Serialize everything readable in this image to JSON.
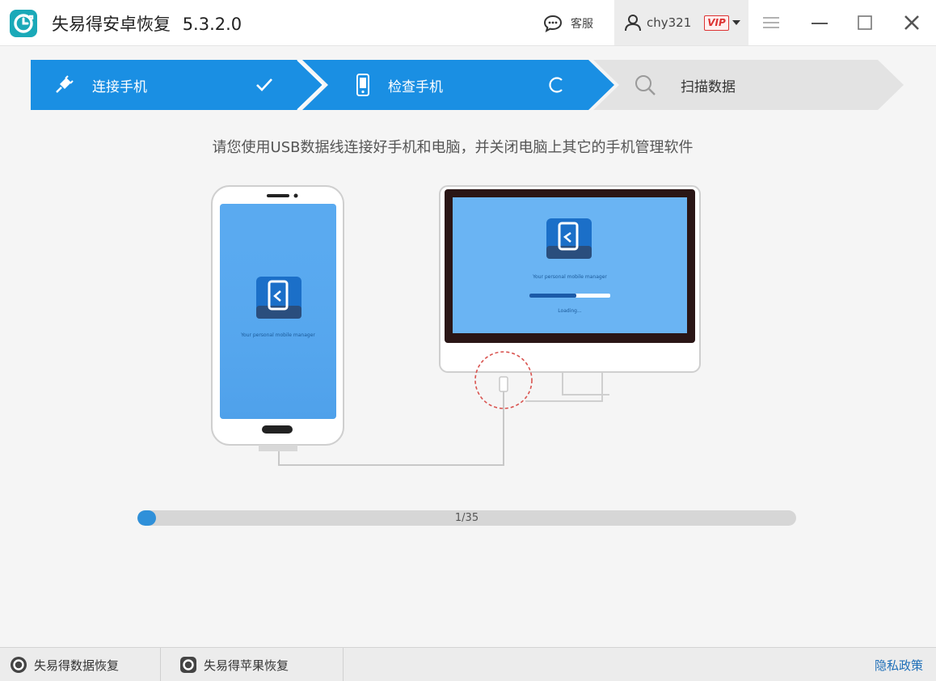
{
  "app": {
    "title": "失易得安卓恢复",
    "version": "5.3.2.0",
    "brand_color": "#1aa9b8"
  },
  "titlebar": {
    "service_label": "客服",
    "username": "chy321",
    "vip_label": "VIP"
  },
  "steps": [
    {
      "label": "连接手机",
      "state": "done",
      "icon": "plug-icon",
      "status_icon": "check-icon"
    },
    {
      "label": "检查手机",
      "state": "active",
      "icon": "phone-icon",
      "status_icon": "loading-icon"
    },
    {
      "label": "扫描数据",
      "state": "pending",
      "icon": "search-icon"
    }
  ],
  "colors": {
    "accent": "#1a8fe3",
    "pending": "#e3e3e3",
    "progress": "#2f90d9",
    "link": "#1f6fb8"
  },
  "instruction": "请您使用USB数据线连接好手机和电脑，并关闭电脑上其它的手机管理软件",
  "illustration": {
    "phone_caption": "Your personal mobile manager",
    "monitor_caption": "Your personal mobile manager",
    "monitor_loading": "Loading..."
  },
  "progress": {
    "current": 1,
    "total": 35,
    "text": "1/35"
  },
  "footer": {
    "link1": "失易得数据恢复",
    "link2": "失易得苹果恢复",
    "privacy": "隐私政策"
  }
}
